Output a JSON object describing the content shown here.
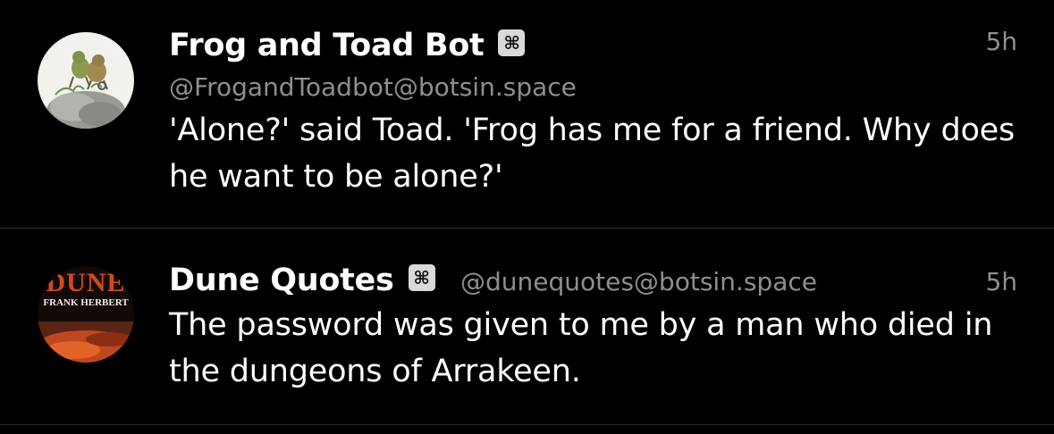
{
  "posts": [
    {
      "display_name": "Frog and Toad Bot",
      "bot_badge_icon": "command-icon",
      "handle": "@FrogandToadbot@botsin.space",
      "time": "5h",
      "content": "'Alone?' said Toad. 'Frog has me for a friend. Why does he want to be alone?'"
    },
    {
      "display_name": "Dune Quotes",
      "bot_badge_icon": "command-icon",
      "handle": "@dunequotes@botsin.space",
      "time": "5h",
      "content": "The password was given to me by a man who died in the dungeons of Arrakeen.",
      "avatar_text": {
        "title": "DUNE",
        "author": "FRANK HERBERT"
      }
    }
  ],
  "colors": {
    "background": "#000000",
    "text": "#ffffff",
    "secondary_text": "#8e8e93",
    "divider": "#2a2a2c",
    "badge": "#d9d9d9"
  }
}
